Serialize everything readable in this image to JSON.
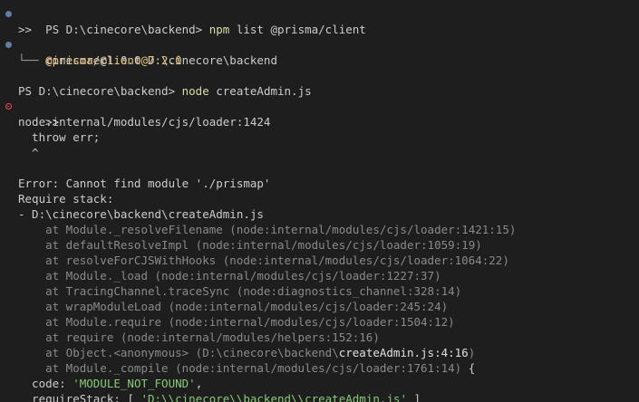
{
  "terminal": {
    "cmd1": {
      "prompt": "PS D:\\cinecore\\backend> ",
      "command": "npm",
      "args": " list @prisma/client"
    },
    "cont1": ">>",
    "out1": "cinecore@1.0.0 D:\\cinecore\\backend",
    "tree_branch": "└── ",
    "pkg": "@prisma/client@7.2.0",
    "cmd2": {
      "prompt": "PS D:\\cinecore\\backend> ",
      "command": "node",
      "args": " createAdmin.js"
    },
    "cont2": ">>",
    "loader_line": "node:internal/modules/cjs/loader:1424",
    "throw_line": "  throw err;",
    "caret_line": "  ^",
    "error_line": "Error: Cannot find module './prismap'",
    "require_stack": "Require stack:",
    "stack_file": "- D:\\cinecore\\backend\\createAdmin.js",
    "frames": [
      "    at Module._resolveFilename (node:internal/modules/cjs/loader:1421:15)",
      "    at defaultResolveImpl (node:internal/modules/cjs/loader:1059:19)",
      "    at resolveForCJSWithHooks (node:internal/modules/cjs/loader:1064:22)",
      "    at Module._load (node:internal/modules/cjs/loader:1227:37)",
      "    at TracingChannel.traceSync (node:diagnostics_channel:328:14)",
      "    at wrapModuleLoad (node:internal/modules/cjs/loader:245:24)",
      "    at Module.require (node:internal/modules/cjs/loader:1504:12)",
      "    at require (node:internal/modules/helpers:152:16)"
    ],
    "frame_obj": {
      "prefix": "    at Object.<anonymous> (",
      "path": "D:\\cinecore\\backend\\",
      "file": "createAdmin.js:4:16",
      "suffix": ")"
    },
    "frame_last": "    at Module._compile (node:internal/modules/cjs/loader:1761:14) ",
    "brace_open": "{",
    "code_key": "  code: ",
    "code_val": "'MODULE_NOT_FOUND'",
    "code_tail": ",",
    "reqstack_key": "  requireStack: [ ",
    "reqstack_val": "'D:\\\\cinecore\\\\backend\\\\createAdmin.js'",
    "reqstack_tail": " ]",
    "colors": {
      "background": "#1e1e1e",
      "text": "#cccccc",
      "command": "#dcdcaa",
      "package": "#e5c07b",
      "dim": "#8a8a8a",
      "string": "#89ca78",
      "success_marker": "#5f7fa6",
      "error_marker": "#f14c4c"
    }
  }
}
